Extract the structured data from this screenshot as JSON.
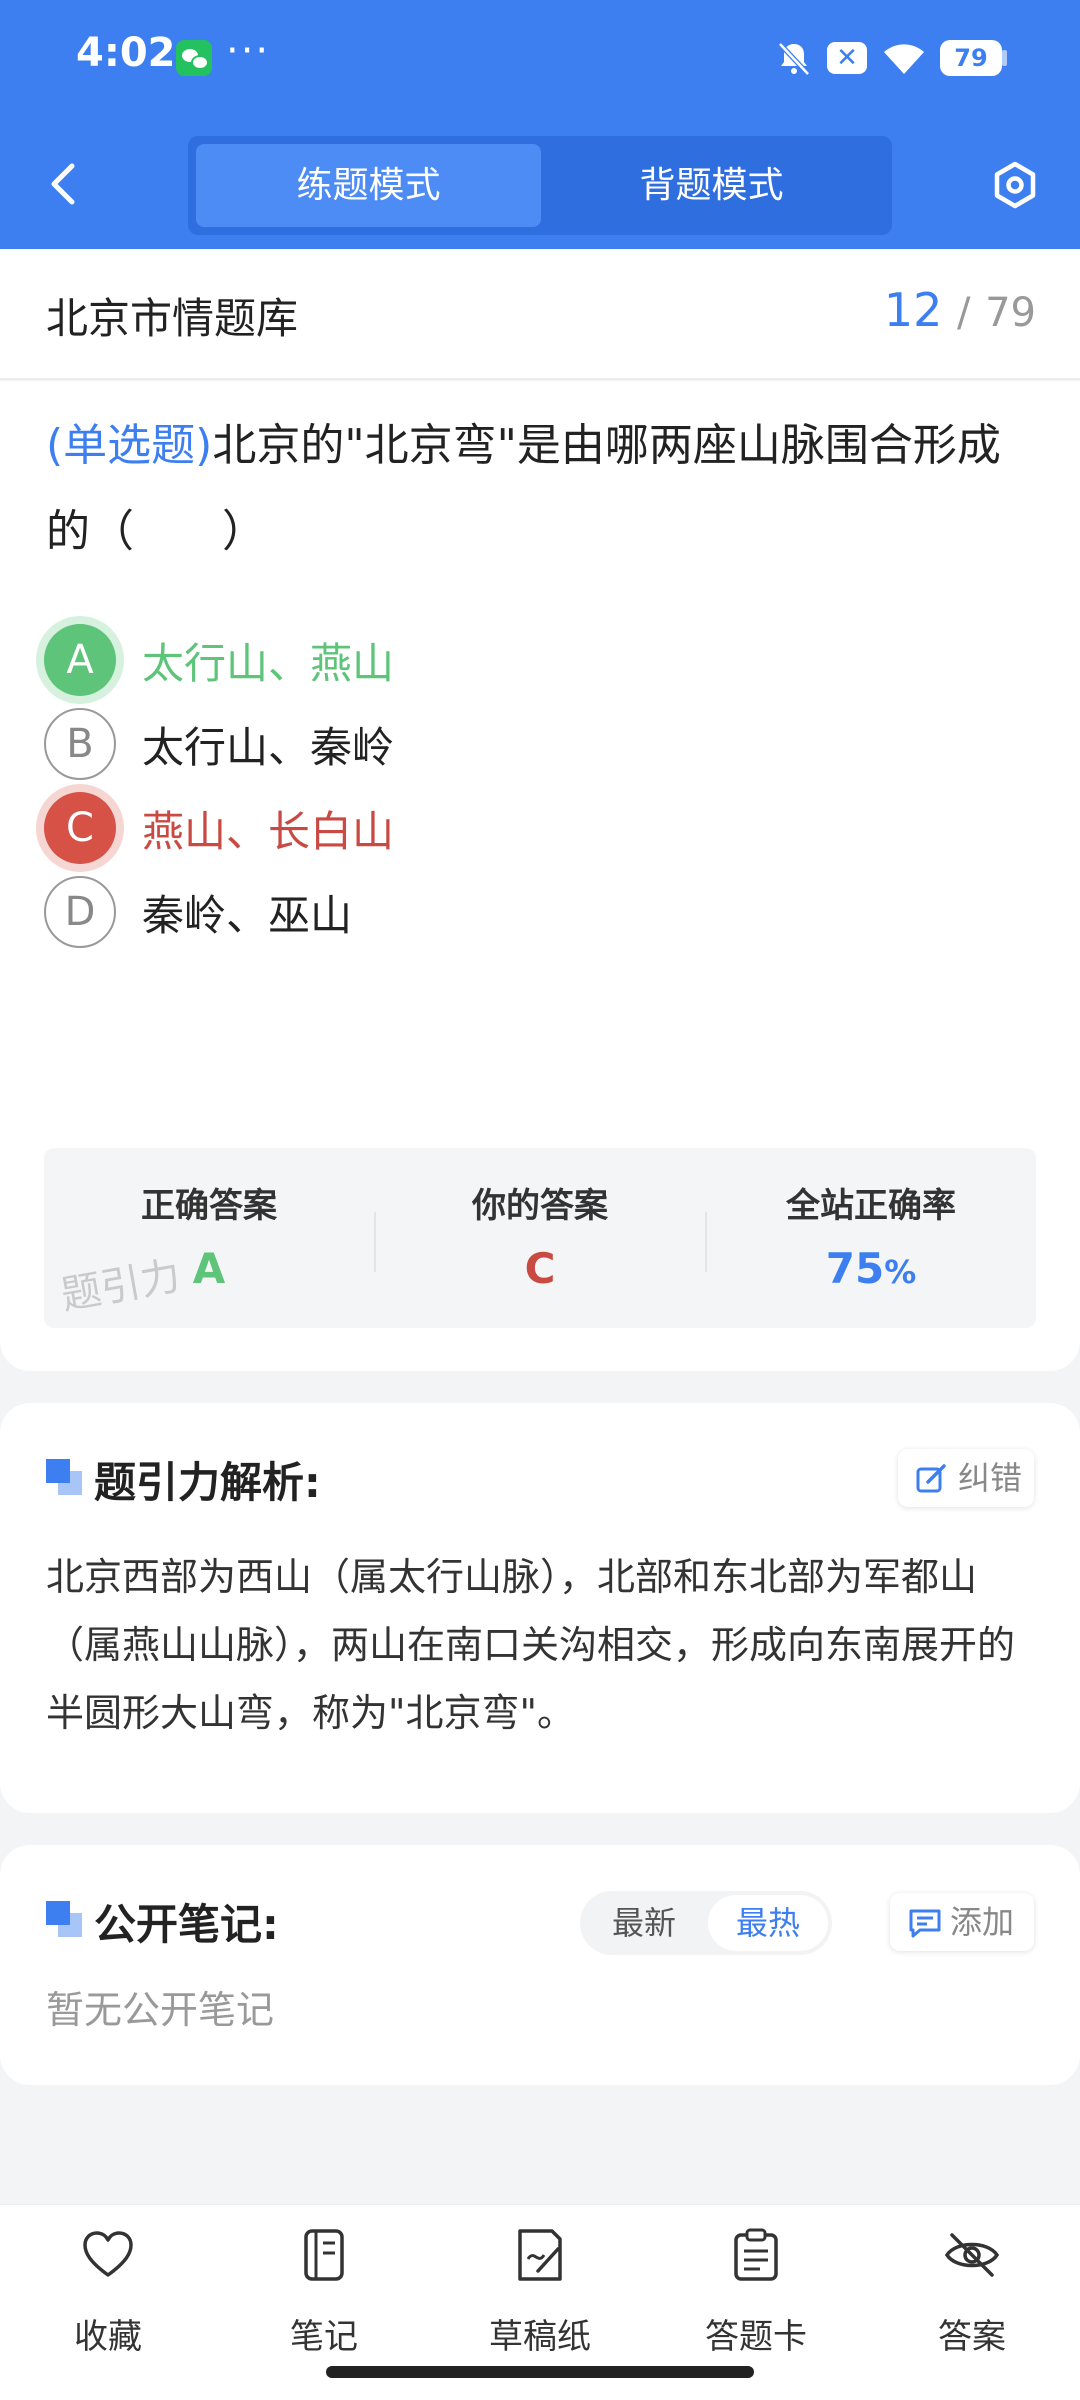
{
  "status_bar": {
    "time": "4:02",
    "dots": "···",
    "battery": "79"
  },
  "header": {
    "modes": {
      "practice": "练题模式",
      "recite": "背题模式"
    }
  },
  "titlebar": {
    "bank_name": "北京市情题库",
    "current": "12",
    "sep": "/",
    "total": "79"
  },
  "question": {
    "type": "(单选题)",
    "text": "北京的\"北京弯\"是由哪两座山脉围合形成的（　　）",
    "options": [
      {
        "letter": "A",
        "text": "太行山、燕山",
        "state": "correct"
      },
      {
        "letter": "B",
        "text": "太行山、秦岭",
        "state": "normal"
      },
      {
        "letter": "C",
        "text": "燕山、长白山",
        "state": "wrong"
      },
      {
        "letter": "D",
        "text": "秦岭、巫山",
        "state": "normal"
      }
    ]
  },
  "stats": {
    "correct_label": "正确答案",
    "correct_value": "A",
    "yours_label": "你的答案",
    "yours_value": "C",
    "rate_label": "全站正确率",
    "rate_value": "75",
    "rate_unit": "%",
    "watermark": "题引力"
  },
  "analysis": {
    "title": "题引力解析:",
    "report_label": "纠错",
    "text": "北京西部为西山（属太行山脉），北部和东北部为军都山（属燕山山脉），两山在南口关沟相交，形成向东南展开的半圆形大山弯，称为\"北京弯\"。"
  },
  "notes": {
    "title": "公开笔记:",
    "sort_latest": "最新",
    "sort_hot": "最热",
    "add_label": "添加",
    "empty_text": "暂无公开笔记"
  },
  "bottom_bar": {
    "items": [
      {
        "label": "收藏",
        "icon": "heart-icon"
      },
      {
        "label": "笔记",
        "icon": "notebook-icon"
      },
      {
        "label": "草稿纸",
        "icon": "draft-paper-icon"
      },
      {
        "label": "答题卡",
        "icon": "answer-card-icon"
      },
      {
        "label": "答案",
        "icon": "eye-off-icon"
      }
    ]
  },
  "colors": {
    "primary": "#3d7ff0",
    "correct": "#5dc47a",
    "wrong": "#d65247"
  }
}
